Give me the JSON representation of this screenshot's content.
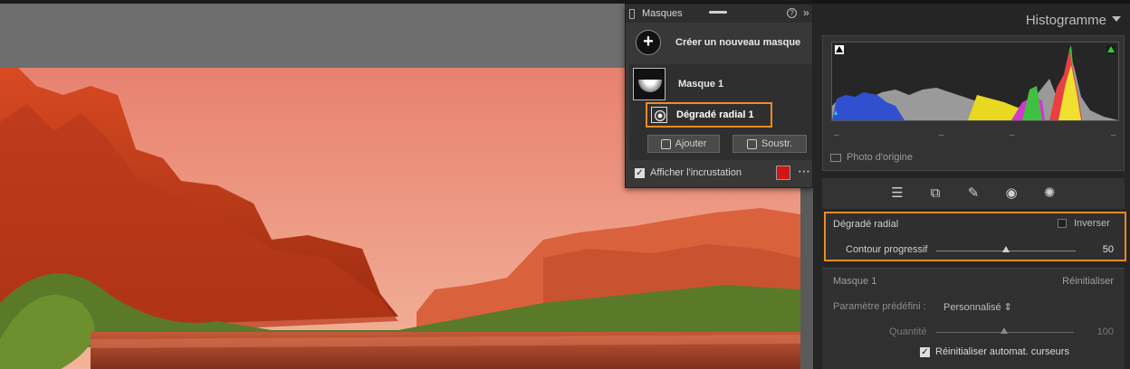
{
  "masks_panel": {
    "title": "Masques",
    "create_label": "Créer un nouveau masque",
    "mask1_label": "Masque 1",
    "radial_label": "Dégradé radial 1",
    "add_label": "Ajouter",
    "subtract_label": "Soustr.",
    "overlay_label": "Afficher l'incrustation",
    "overlay_checked": true,
    "overlay_color": "#d01515"
  },
  "histogram": {
    "title": "Histogramme",
    "original_photo_label": "Photo d'origine"
  },
  "tools": [
    "sliders-icon",
    "crop-icon",
    "heal-icon",
    "redeye-icon",
    "mask-icon"
  ],
  "radial_section": {
    "title": "Dégradé radial",
    "invert_label": "Inverser",
    "feather_label": "Contour progressif",
    "feather_value": "50"
  },
  "mask_section": {
    "title": "Masque 1",
    "reset_label": "Réinitialiser",
    "preset_label": "Paramètre prédéfini :",
    "preset_value": "Personnalisé ⇕",
    "amount_label": "Quantité",
    "amount_value": "100",
    "auto_reset_label": "Réinitialiser automat. curseurs",
    "auto_reset_checked": true
  },
  "colors": {
    "accent": "#f08a24"
  }
}
